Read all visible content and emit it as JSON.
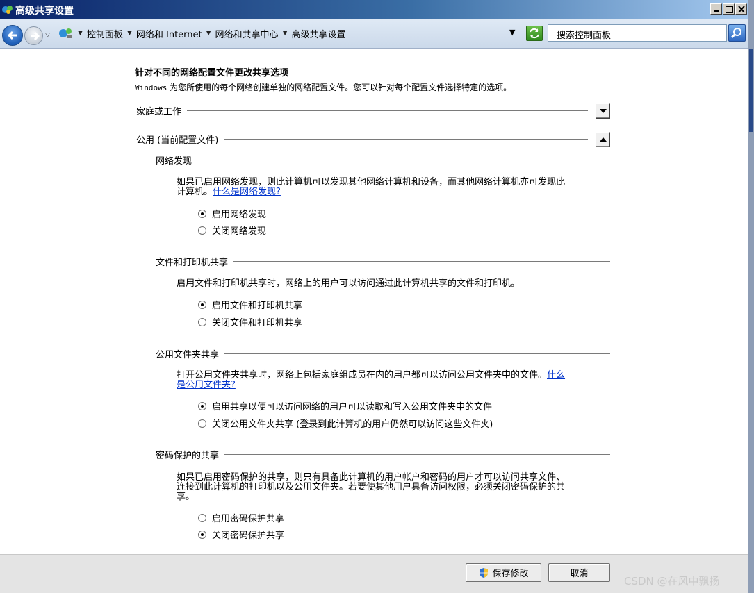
{
  "window": {
    "title": "高级共享设置"
  },
  "address_bar": {
    "breadcrumbs": [
      "控制面板",
      "网络和 Internet",
      "网络和共享中心",
      "高级共享设置"
    ],
    "search_placeholder": "搜索控制面板"
  },
  "main": {
    "heading": "针对不同的网络配置文件更改共享选项",
    "subheading_prefix": "Windows",
    "subheading_rest": " 为您所使用的每个网络创建单独的网络配置文件。您可以针对每个配置文件选择特定的选项。",
    "profiles": [
      {
        "label": "家庭或工作",
        "expanded": false
      },
      {
        "label": "公用 (当前配置文件)",
        "expanded": true
      }
    ],
    "sections": {
      "network_discovery": {
        "title": "网络发现",
        "description_line1": "如果已启用网络发现，则此计算机可以发现其他网络计算机和设备，而其他网络计算机亦可发现此",
        "description_line2": "计算机。",
        "link": "什么是网络发现?",
        "options": [
          {
            "label": "启用网络发现",
            "checked": true
          },
          {
            "label": "关闭网络发现",
            "checked": false
          }
        ]
      },
      "file_printer_sharing": {
        "title": "文件和打印机共享",
        "description": "启用文件和打印机共享时，网络上的用户可以访问通过此计算机共享的文件和打印机。",
        "options": [
          {
            "label": "启用文件和打印机共享",
            "checked": true
          },
          {
            "label": "关闭文件和打印机共享",
            "checked": false
          }
        ]
      },
      "public_folder_sharing": {
        "title": "公用文件夹共享",
        "description": "打开公用文件夹共享时，网络上包括家庭组成员在内的用户都可以访问公用文件夹中的文件。",
        "link_part1": "什么",
        "link_part2": "是公用文件夹?",
        "options": [
          {
            "label": "启用共享以便可以访问网络的用户可以读取和写入公用文件夹中的文件",
            "checked": true
          },
          {
            "label": "关闭公用文件夹共享 (登录到此计算机的用户仍然可以访问这些文件夹)",
            "checked": false
          }
        ]
      },
      "password_protected_sharing": {
        "title": "密码保护的共享",
        "description_line1": "如果已启用密码保护的共享，则只有具备此计算机的用户帐户和密码的用户才可以访问共享文件、",
        "description_line2": "连接到此计算机的打印机以及公用文件夹。若要使其他用户具备访问权限，必须关闭密码保护的共",
        "description_line3": "享。",
        "options": [
          {
            "label": "启用密码保护共享",
            "checked": false
          },
          {
            "label": "关闭密码保护共享",
            "checked": true
          }
        ]
      }
    }
  },
  "footer": {
    "save_label": "保存修改",
    "cancel_label": "取消",
    "watermark": "CSDN @在风中飘扬"
  },
  "icons": {
    "app": "network-sharing-icon",
    "back": "back-arrow-icon",
    "forward": "forward-arrow-icon",
    "refresh": "refresh-icon",
    "search": "search-icon",
    "save": "uac-shield-icon"
  },
  "colors": {
    "titlebar_start": "#0a246a",
    "titlebar_end": "#a6caf0",
    "link": "#0033cc",
    "footer_bg": "#e4e4e4"
  }
}
